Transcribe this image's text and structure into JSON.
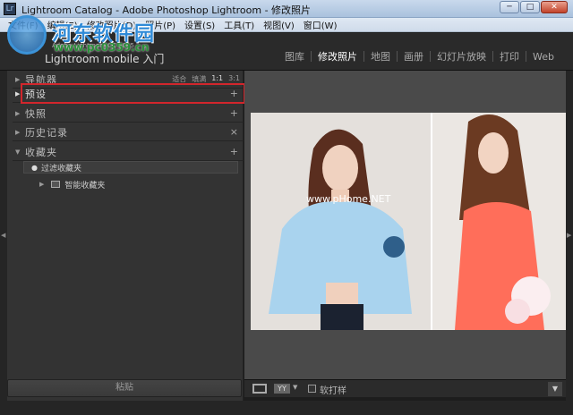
{
  "window": {
    "title": "Lightroom Catalog - Adobe Photoshop Lightroom - 修改照片",
    "app_icon": "Lr",
    "min": "─",
    "max": "□",
    "close": "✕"
  },
  "menubar": [
    "文件(F)",
    "编辑(E)",
    "修改照片(D)",
    "照片(P)",
    "设置(S)",
    "工具(T)",
    "视图(V)",
    "窗口(W)"
  ],
  "watermark": {
    "text": "河东软件园",
    "url": "www.pc0359.cn"
  },
  "identity": {
    "subtitle": "Adobe Lightroom CC 2015",
    "main": "Lightroom mobile 入门"
  },
  "modules": [
    {
      "label": "图库",
      "active": false
    },
    {
      "label": "修改照片",
      "active": true
    },
    {
      "label": "地图",
      "active": false
    },
    {
      "label": "画册",
      "active": false
    },
    {
      "label": "幻灯片放映",
      "active": false
    },
    {
      "label": "打印",
      "active": false
    },
    {
      "label": "Web",
      "active": false
    }
  ],
  "left_panel": {
    "navigator": {
      "label": "导航器",
      "options": [
        "适合",
        "填满",
        "1:1",
        "3:1"
      ],
      "selected": "1:1"
    },
    "presets": {
      "label": "预设"
    },
    "snapshots": {
      "label": "快照"
    },
    "history": {
      "label": "历史记录"
    },
    "collections": {
      "label": "收藏夹",
      "items": [
        "过滤收藏夹",
        "智能收藏夹"
      ]
    },
    "paste_button": "粘贴"
  },
  "photo_watermark": "www.pHome.NET",
  "toolbar": {
    "yy_label": "YY",
    "soft_proof_label": "软打样"
  },
  "colors": {
    "highlight_red": "#d2262c",
    "panel_bg": "#333333",
    "center_bg": "#4a4a4a"
  }
}
